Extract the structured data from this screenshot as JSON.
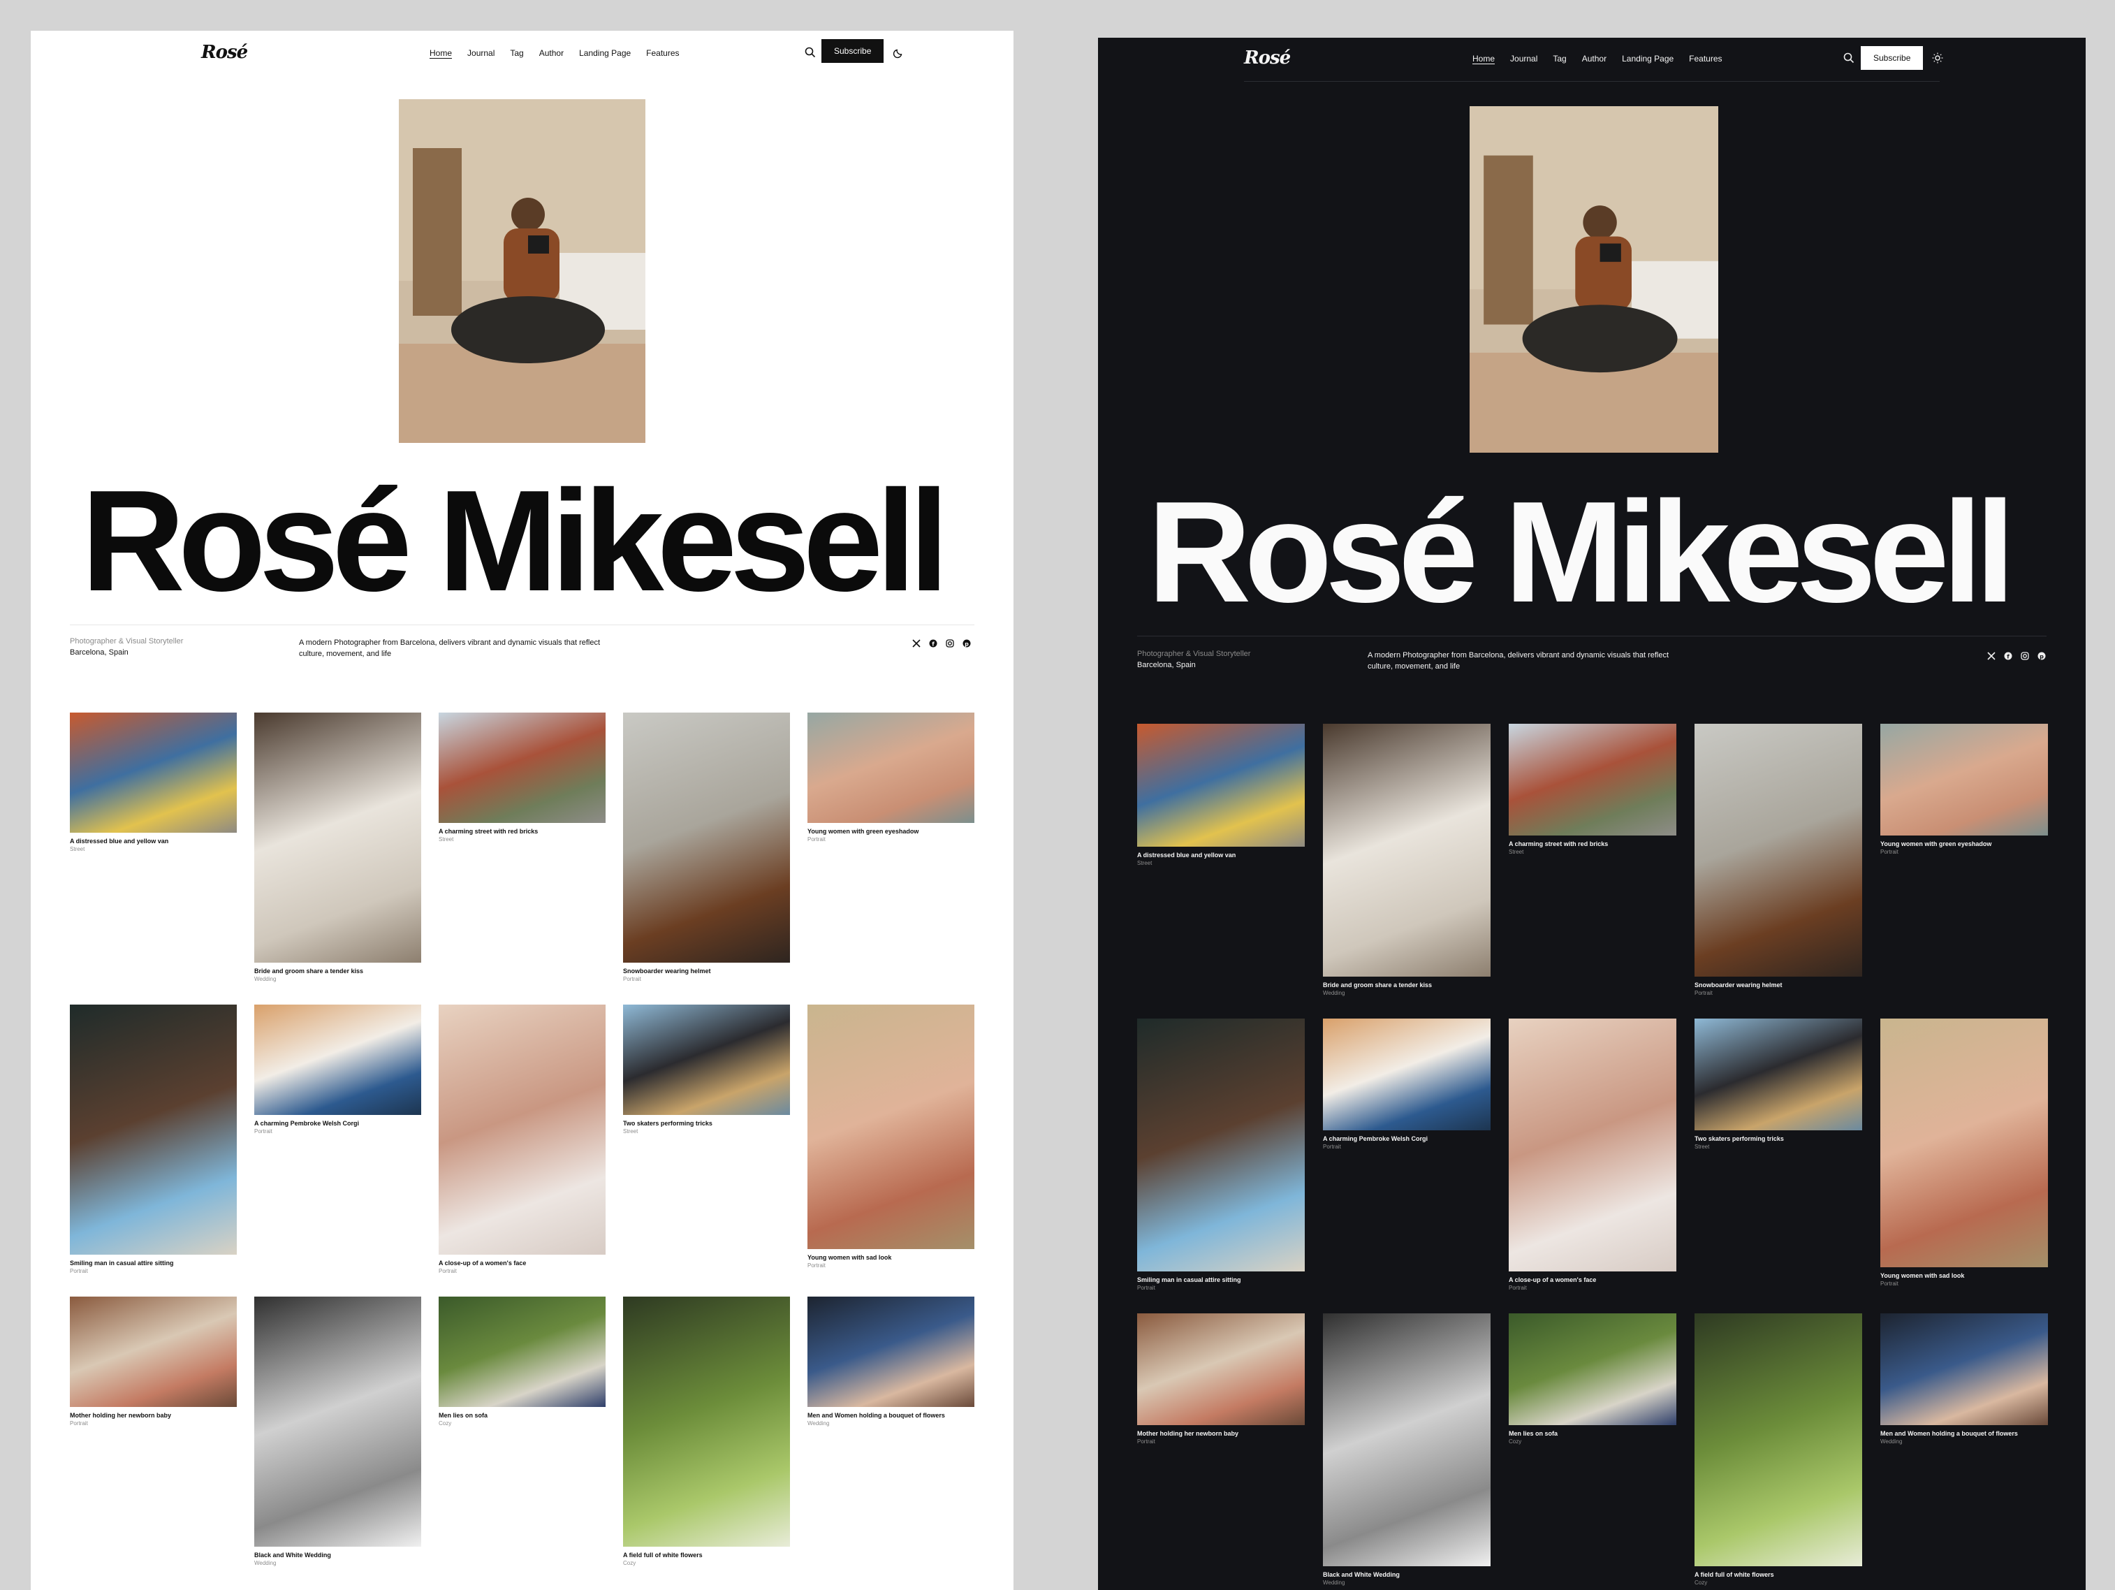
{
  "site": {
    "logo": "Rosé",
    "nav": [
      "Home",
      "Journal",
      "Tag",
      "Author",
      "Landing Page",
      "Features"
    ],
    "active_nav": "Home",
    "subscribe_label": "Subscribe"
  },
  "profile": {
    "name": "Rosé Mikesell",
    "role": "Photographer & Visual Storyteller",
    "location": "Barcelona, Spain",
    "description": "A modern Photographer from Barcelona, delivers vibrant and dynamic visuals that reflect culture, movement, and life",
    "social_icons": [
      "x-icon",
      "facebook-icon",
      "instagram-icon",
      "pinterest-icon"
    ]
  },
  "posts": [
    {
      "title": "A distressed blue and yellow van",
      "tag": "Street",
      "colors": [
        "#c85a2e",
        "#3f6fa0",
        "#e2c24e",
        "#8e8a82"
      ]
    },
    {
      "title": "Bride and groom share a tender kiss",
      "tag": "Wedding",
      "colors": [
        "#4a3a2e",
        "#e9e4dc",
        "#cfc7bb",
        "#8d7f6f"
      ]
    },
    {
      "title": "A charming street with red bricks",
      "tag": "Street",
      "colors": [
        "#c8d6e0",
        "#a9523a",
        "#6f7d5a",
        "#8e8d88"
      ]
    },
    {
      "title": "Snowboarder wearing helmet",
      "tag": "Portrait",
      "colors": [
        "#c9c9c4",
        "#a9a59b",
        "#6b3e22",
        "#2e2520"
      ]
    },
    {
      "title": "Young women with green eyeshadow",
      "tag": "Portrait",
      "colors": [
        "#96a7a3",
        "#d9a98e",
        "#c98f74",
        "#7c8f8d"
      ]
    },
    {
      "title": "Smiling man in casual attire sitting",
      "tag": "Portrait",
      "colors": [
        "#1f2b2a",
        "#5b4030",
        "#7fb6d9",
        "#d9d2c4"
      ]
    },
    {
      "title": "A charming Pembroke Welsh Corgi",
      "tag": "Portrait",
      "colors": [
        "#d9a06a",
        "#f2ede6",
        "#2d5a8f",
        "#1d3550"
      ]
    },
    {
      "title": "A close-up of a women's face",
      "tag": "Portrait",
      "colors": [
        "#e8d2c1",
        "#c99782",
        "#ede6e2",
        "#d7cbc4"
      ]
    },
    {
      "title": "Two skaters performing tricks",
      "tag": "Street",
      "colors": [
        "#8fb9d6",
        "#2b2b2f",
        "#c9a46a",
        "#6a8aa0"
      ]
    },
    {
      "title": "Young women with sad look",
      "tag": "Portrait",
      "colors": [
        "#c9b58e",
        "#e0b399",
        "#b86a50",
        "#a4906a"
      ]
    },
    {
      "title": "Mother holding her newborn baby",
      "tag": "Portrait",
      "colors": [
        "#8a5a3e",
        "#d9c8b4",
        "#c47b63",
        "#6a4a38"
      ]
    },
    {
      "title": "Black and White Wedding",
      "tag": "Wedding",
      "colors": [
        "#303030",
        "#d0d0d0",
        "#8a8a8a",
        "#f0f0f0"
      ]
    },
    {
      "title": "Men lies on sofa",
      "tag": "Cozy",
      "colors": [
        "#3b5a2a",
        "#6a8a3e",
        "#d8d4c8",
        "#2f3f6a"
      ]
    },
    {
      "title": "A field full of white flowers",
      "tag": "Cozy",
      "colors": [
        "#2e3a22",
        "#6c8d3a",
        "#aac86a",
        "#e8ecd8"
      ]
    },
    {
      "title": "Men and Women holding a bouquet of flowers",
      "tag": "Wedding",
      "colors": [
        "#1d2430",
        "#3a5a8a",
        "#d9b8a0",
        "#6a4a3a"
      ]
    }
  ]
}
